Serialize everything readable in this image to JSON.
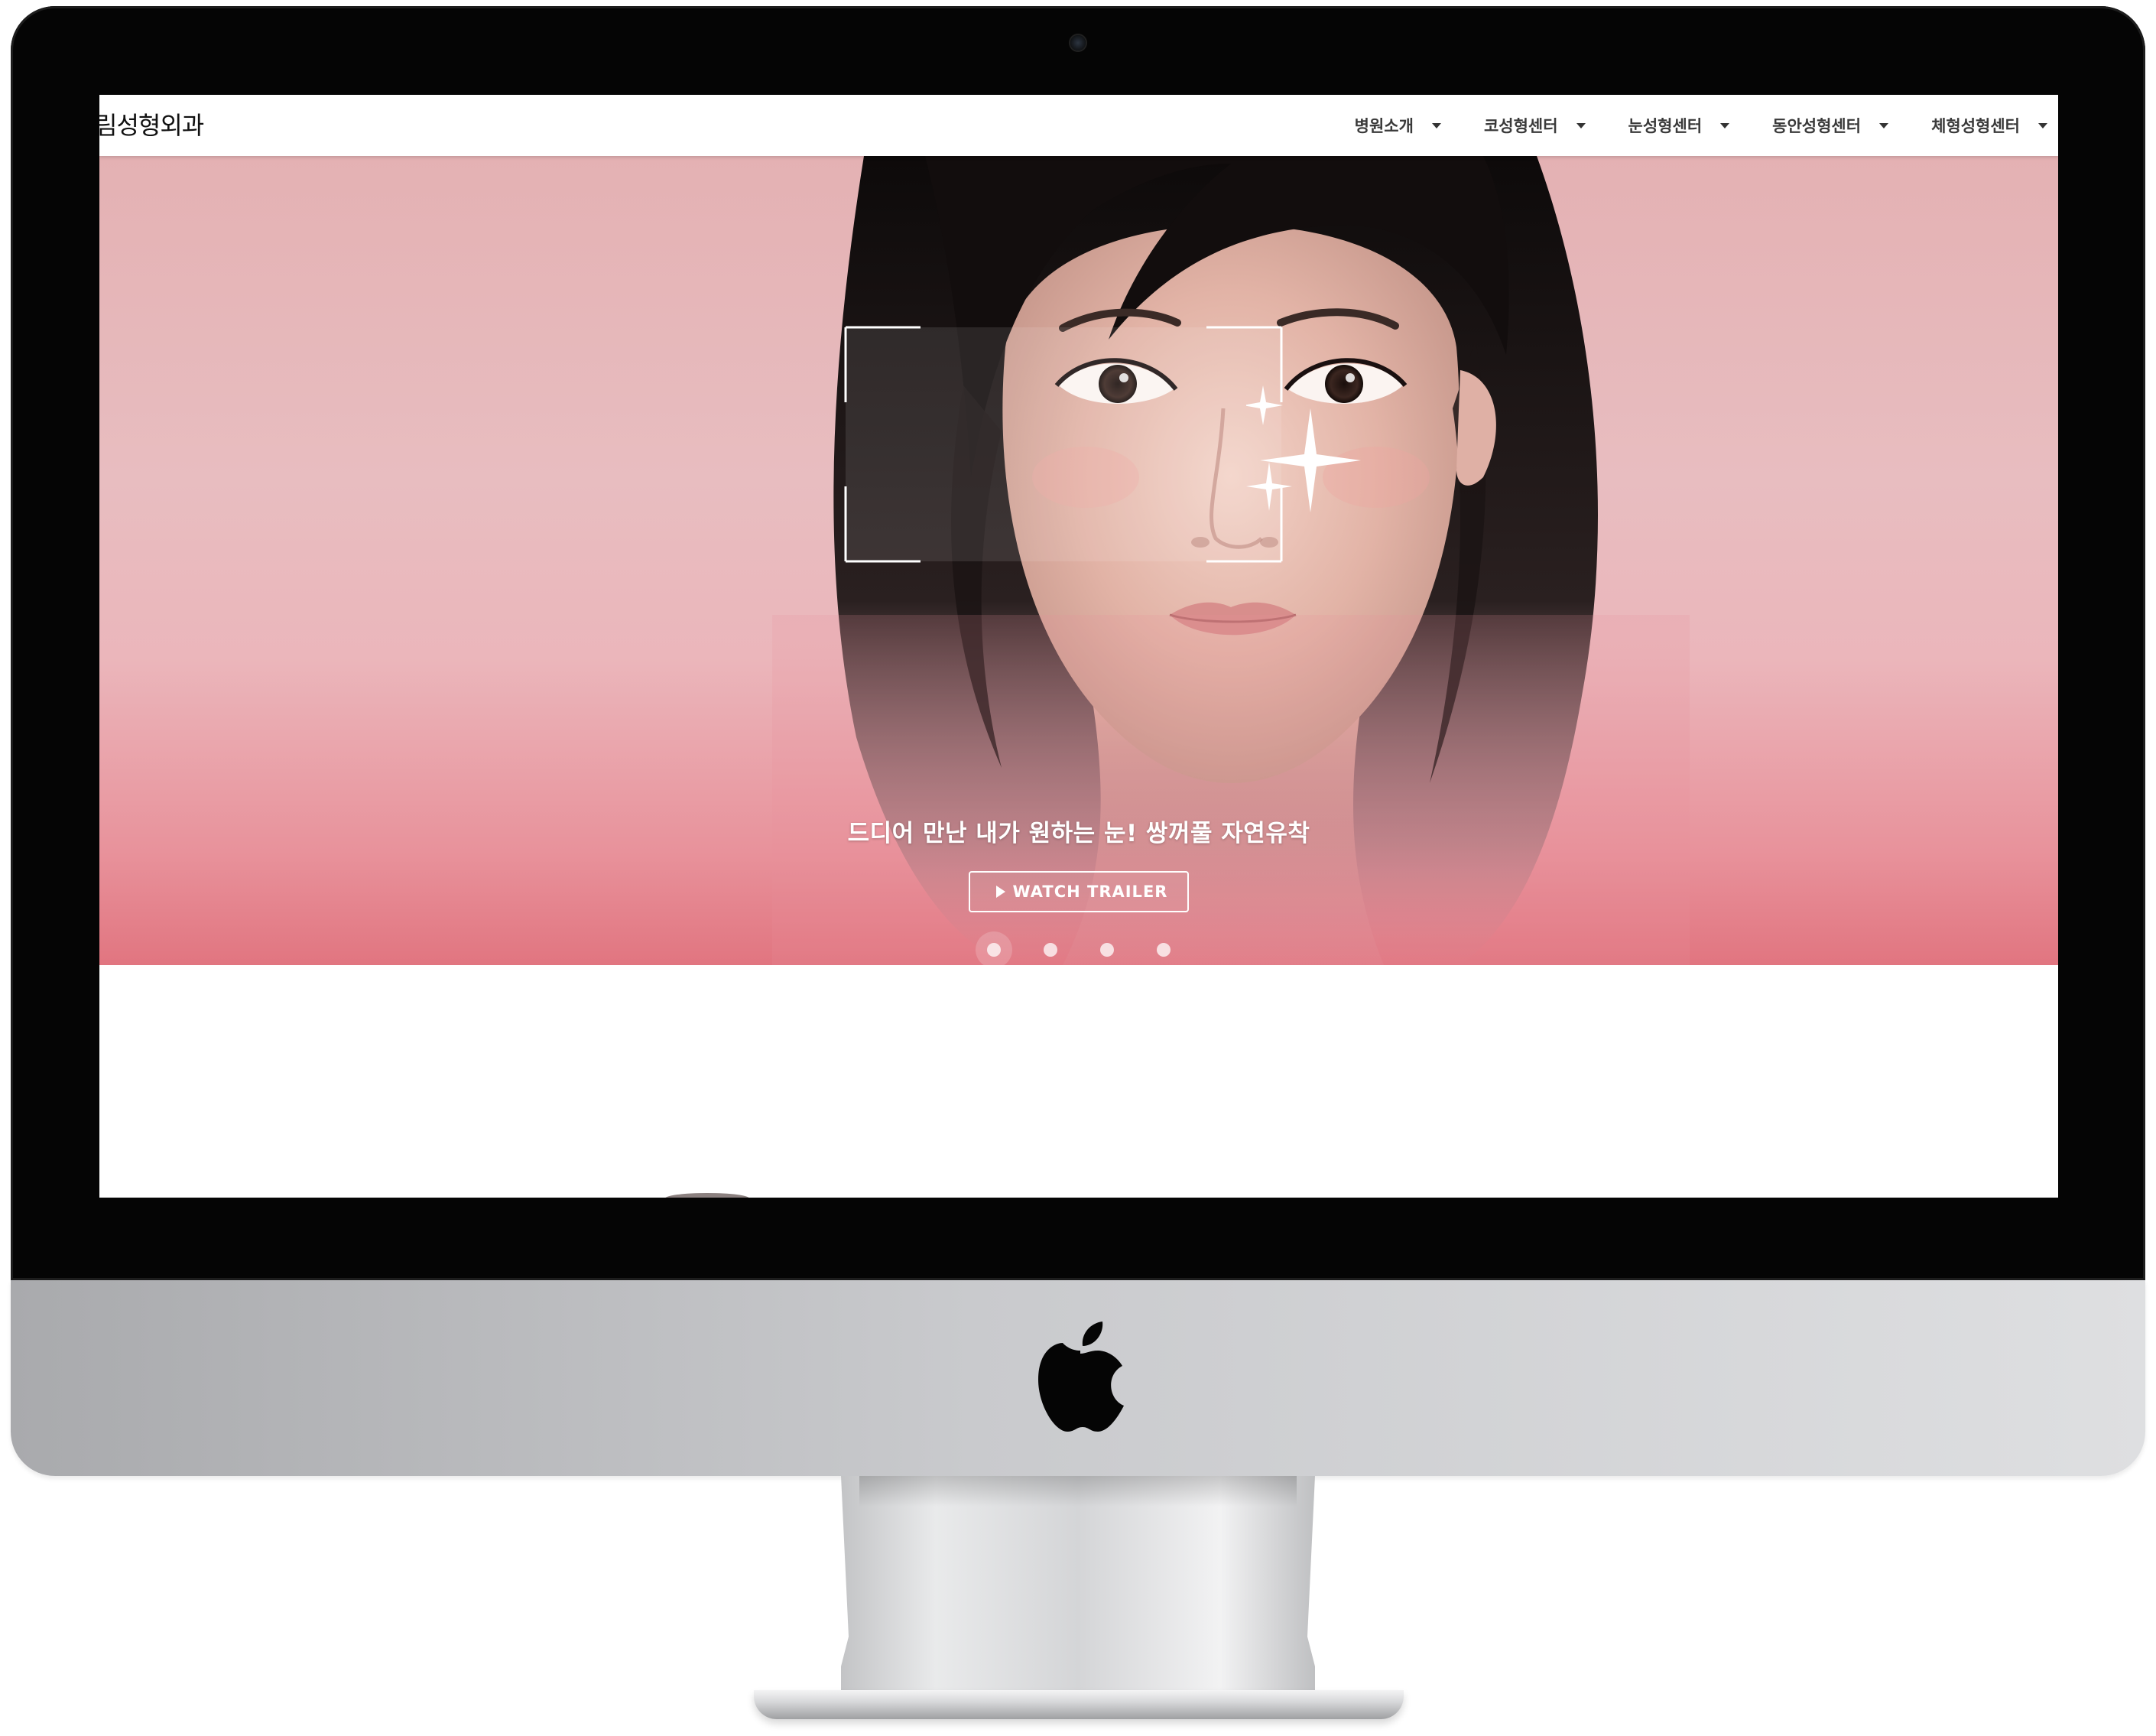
{
  "brand": {
    "name": "림성형외과"
  },
  "nav": {
    "items": [
      {
        "label": "병원소개"
      },
      {
        "label": "코성형센터"
      },
      {
        "label": "눈성형센터"
      },
      {
        "label": "동안성형센터"
      },
      {
        "label": "체형성형센터"
      }
    ]
  },
  "hero": {
    "title": "드디어 만난 내가 원하는 눈! 쌍꺼풀 자연유착",
    "button_label": "WATCH TRAILER",
    "slides_total": 4,
    "active_slide": 1
  },
  "colors": {
    "hero_top": "#e4b1b3",
    "hero_bottom": "#e17580",
    "bezel": "#050505",
    "chin": "#c9cacd"
  },
  "icons": {
    "play": "play-icon",
    "caret": "caret-down-icon",
    "apple": "apple-logo-icon"
  }
}
